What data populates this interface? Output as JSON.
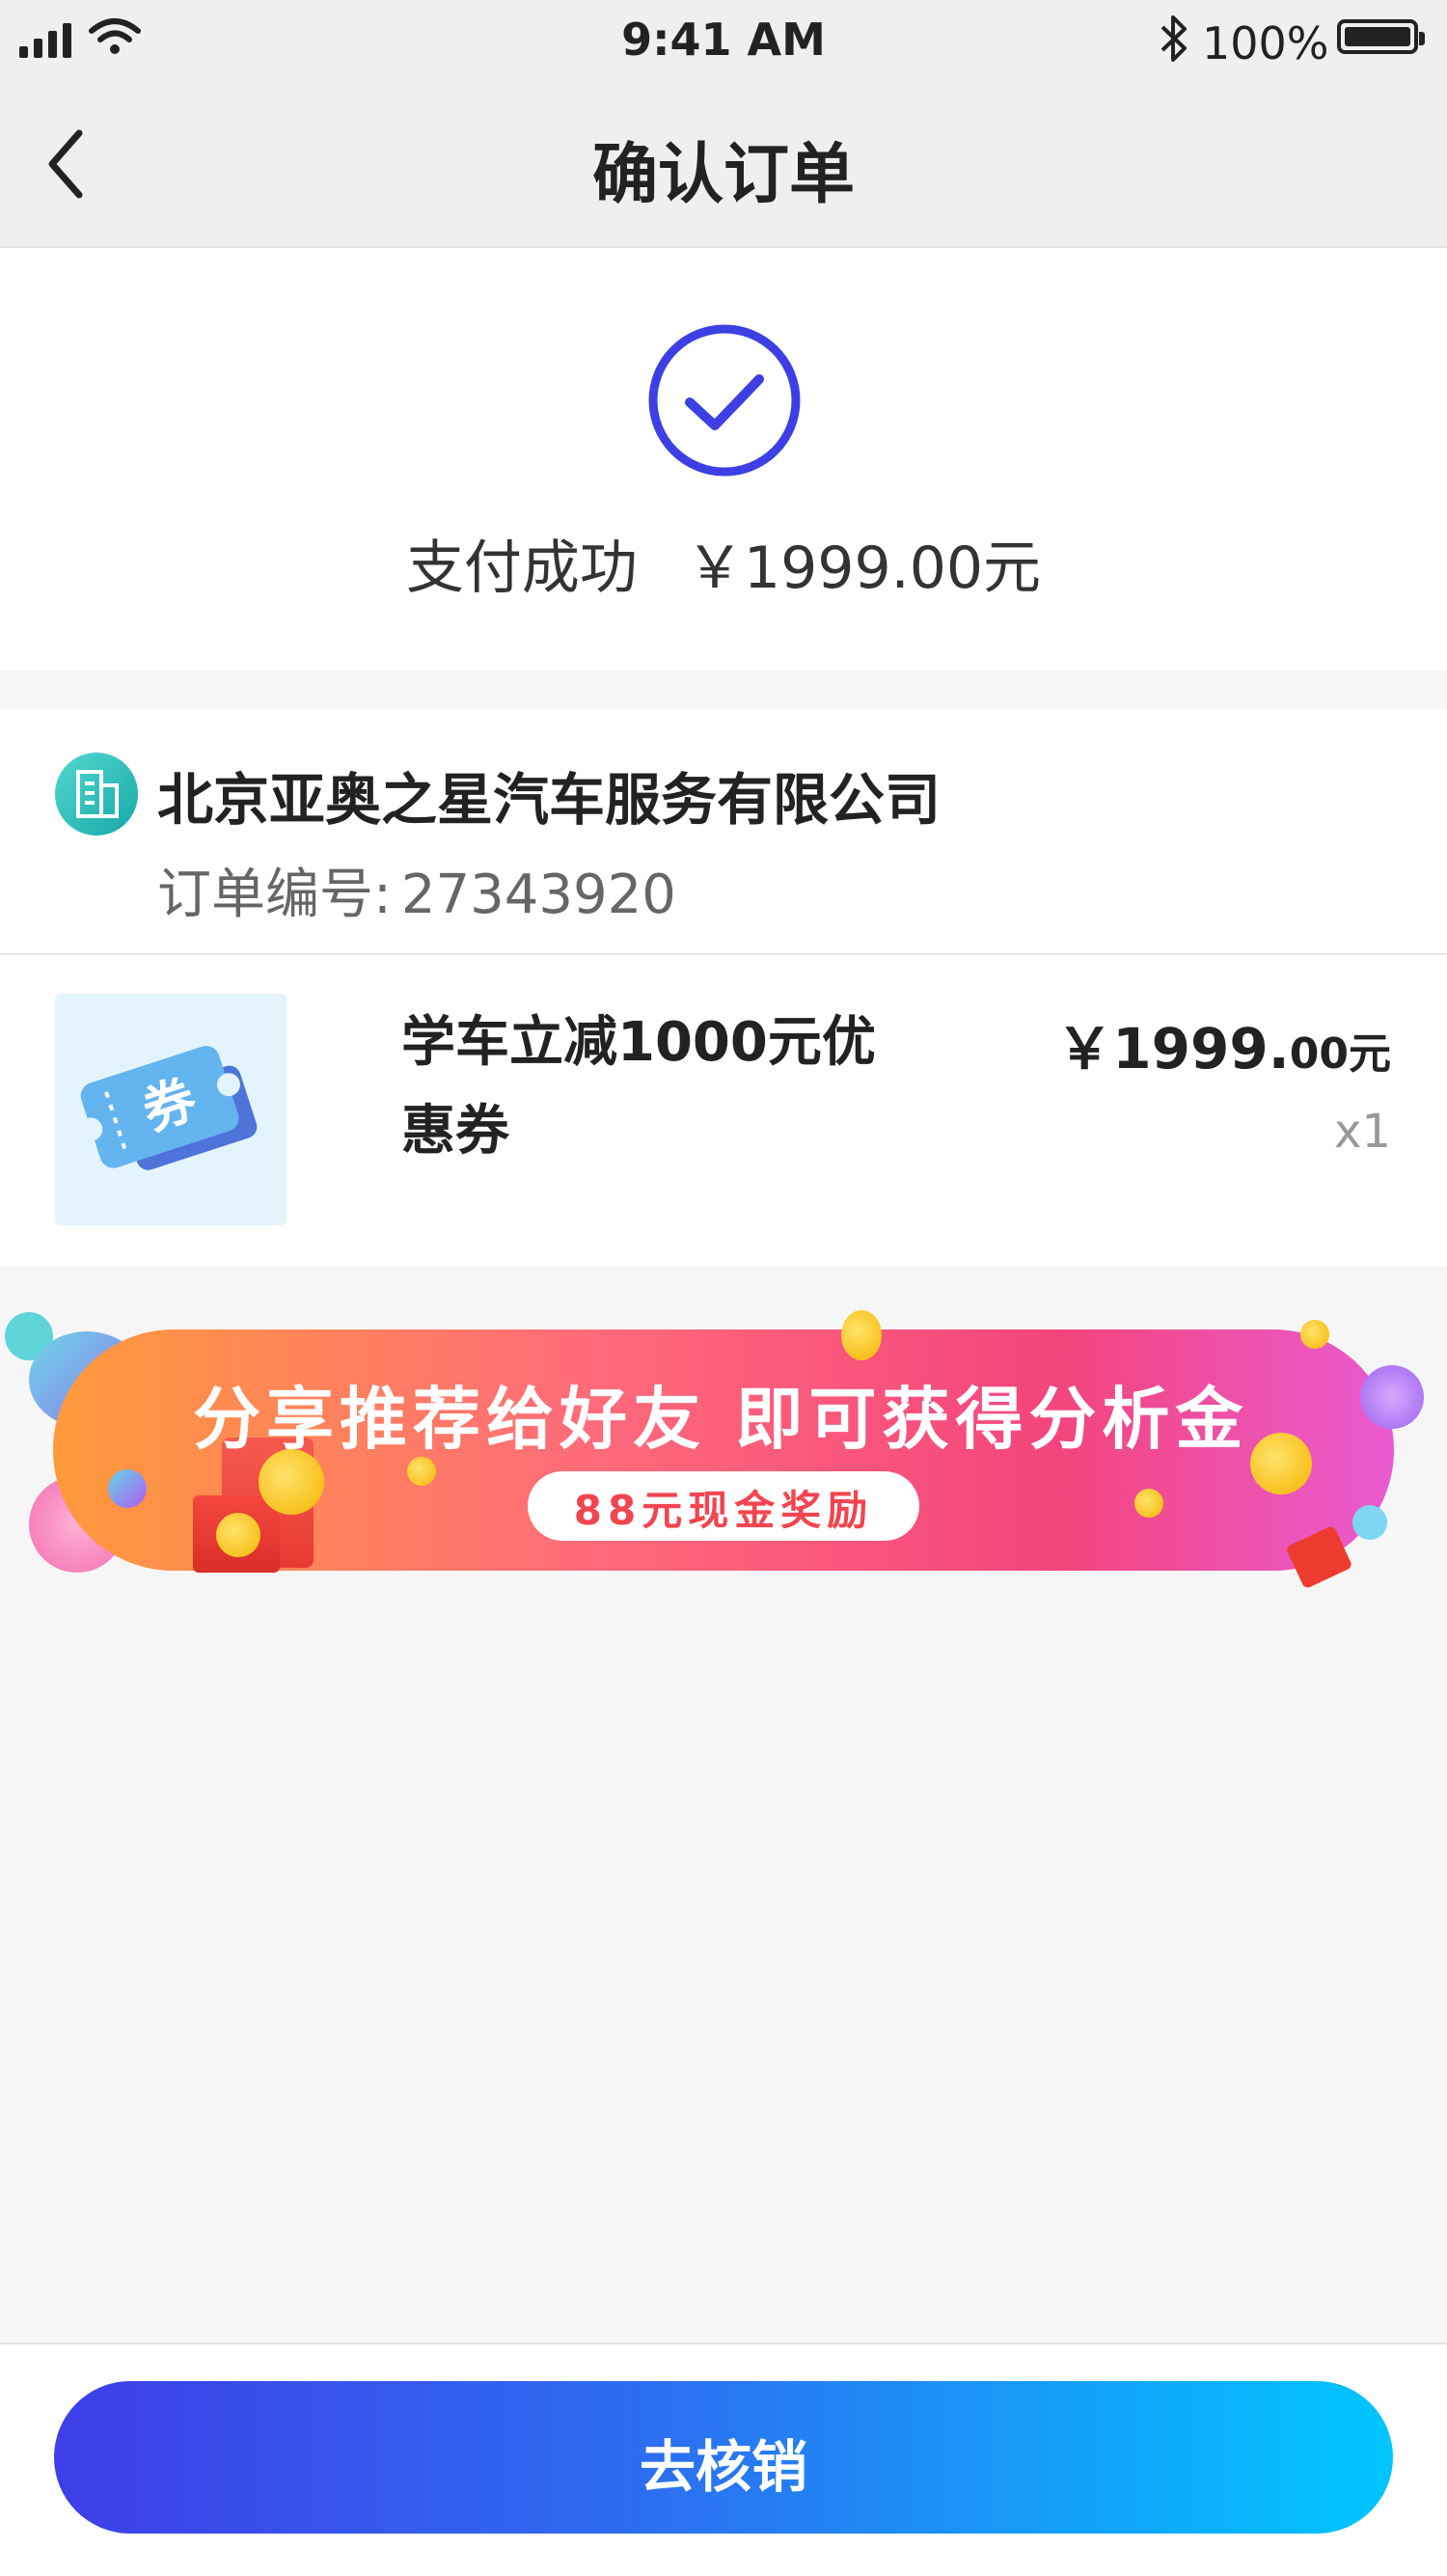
{
  "status_bar": {
    "time": "9:41 AM",
    "battery": "100%"
  },
  "nav": {
    "title": "确认订单",
    "back_icon": "chevron-left-icon"
  },
  "payment": {
    "status": "支付成功",
    "amount": "￥1999.00元",
    "icon": "check-circle-icon",
    "accent": "#3d3fe4"
  },
  "merchant": {
    "name": "北京亚奥之星汽车服务有限公司",
    "order_label": "订单编号:",
    "order_number": "27343920",
    "icon": "building-icon"
  },
  "product": {
    "title": "学车立减1000元优惠券",
    "price_main": "￥1999.",
    "price_decimal": "00元",
    "quantity": "x1",
    "thumbnail_glyph": "券",
    "thumbnail_icon": "coupon-ticket-icon"
  },
  "banner": {
    "title": "分享推荐给好友 即可获得分析金",
    "subtitle": "88元现金奖励"
  },
  "footer": {
    "cta_label": "去核销",
    "cta_colors": [
      "#3e3ee8",
      "#00c6ff"
    ]
  }
}
